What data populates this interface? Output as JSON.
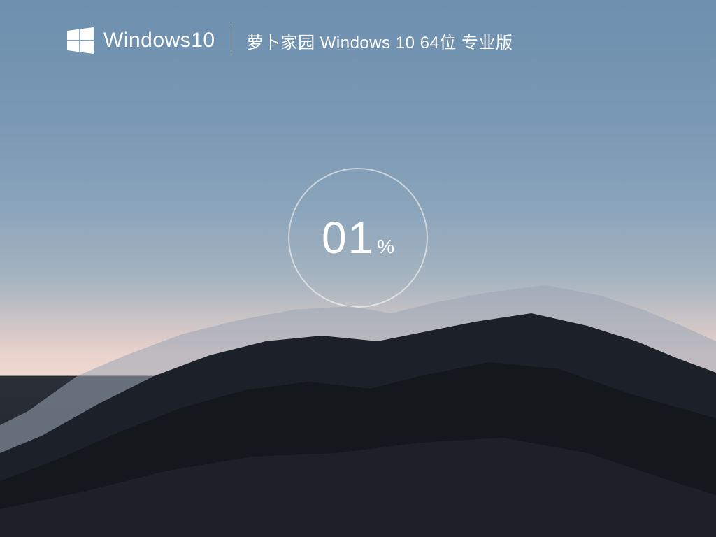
{
  "header": {
    "brand": "Windows10",
    "edition": "萝卜家园 Windows 10 64位 专业版"
  },
  "progress": {
    "value": "01",
    "unit": "%"
  },
  "icons": {
    "windows_logo": "windows-logo-icon"
  },
  "colors": {
    "text": "#ffffff",
    "ring": "rgba(255,255,255,0.55)"
  }
}
